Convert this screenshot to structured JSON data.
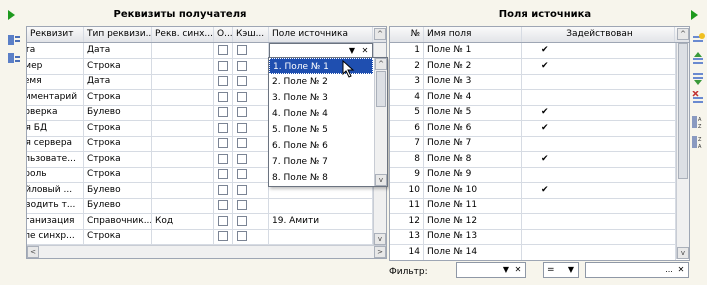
{
  "left_panel": {
    "title": "Реквизиты получателя",
    "columns": [
      "Реквизит",
      "Тип реквизи...",
      "Рекв. синх...",
      "О...",
      "Кэш...",
      "Поле источника"
    ],
    "rows": [
      {
        "name": "Дата",
        "type": "Дата",
        "sync": "",
        "source": ""
      },
      {
        "name": "Номер",
        "type": "Строка",
        "sync": "",
        "source": ""
      },
      {
        "name": "Время",
        "type": "Дата",
        "sync": "",
        "source": ""
      },
      {
        "name": "Комментарий",
        "type": "Строка",
        "sync": "",
        "source": ""
      },
      {
        "name": "Проверка",
        "type": "Булево",
        "sync": "",
        "source": ""
      },
      {
        "name": "Имя БД",
        "type": "Строка",
        "sync": "",
        "source": ""
      },
      {
        "name": "Имя сервера",
        "type": "Строка",
        "sync": "",
        "source": ""
      },
      {
        "name": "Пользовате...",
        "type": "Строка",
        "sync": "",
        "source": ""
      },
      {
        "name": "Пароль",
        "type": "Строка",
        "sync": "",
        "source": ""
      },
      {
        "name": "Файловый ...",
        "type": "Булево",
        "sync": "",
        "source": ""
      },
      {
        "name": "Выводить т...",
        "type": "Булево",
        "sync": "",
        "source": ""
      },
      {
        "name": "Организация",
        "type": "Справочник...",
        "sync": "Код",
        "source": "19. Амити"
      },
      {
        "name": "Поле синхр...",
        "type": "Строка",
        "sync": "",
        "source": ""
      }
    ],
    "dropdown_items": [
      "1. Поле № 1",
      "2. Поле № 2",
      "3. Поле № 3",
      "4. Поле № 4",
      "5. Поле № 5",
      "6. Поле № 6",
      "7. Поле № 7",
      "8. Поле № 8"
    ],
    "dropdown_selected": "1. Поле № 1"
  },
  "right_panel": {
    "title": "Поля источника",
    "columns": [
      "№",
      "Имя поля",
      "Задействован"
    ],
    "rows": [
      {
        "n": "1",
        "name": "Поле № 1",
        "used": true
      },
      {
        "n": "2",
        "name": "Поле № 2",
        "used": true
      },
      {
        "n": "3",
        "name": "Поле № 3",
        "used": false
      },
      {
        "n": "4",
        "name": "Поле № 4",
        "used": false
      },
      {
        "n": "5",
        "name": "Поле № 5",
        "used": true
      },
      {
        "n": "6",
        "name": "Поле № 6",
        "used": true
      },
      {
        "n": "7",
        "name": "Поле № 7",
        "used": false
      },
      {
        "n": "8",
        "name": "Поле № 8",
        "used": true
      },
      {
        "n": "9",
        "name": "Поле № 9",
        "used": false
      },
      {
        "n": "10",
        "name": "Поле № 10",
        "used": true
      },
      {
        "n": "11",
        "name": "Поле № 11",
        "used": false
      },
      {
        "n": "12",
        "name": "Поле № 12",
        "used": false
      },
      {
        "n": "13",
        "name": "Поле № 13",
        "used": false
      },
      {
        "n": "14",
        "name": "Поле № 14",
        "used": false
      }
    ],
    "filter_label": "Фильтр:",
    "filter_op": "=",
    "filter_value": "",
    "checkmark": "✔"
  },
  "colors": {
    "accent_green": "#1e9a1e",
    "selection": "#1f4fb0"
  },
  "icons": [
    "play-icon",
    "table-sort-icon",
    "add-icon",
    "move-up-icon",
    "move-down-icon",
    "delete-icon",
    "sort-asc-icon",
    "sort-desc-icon"
  ]
}
